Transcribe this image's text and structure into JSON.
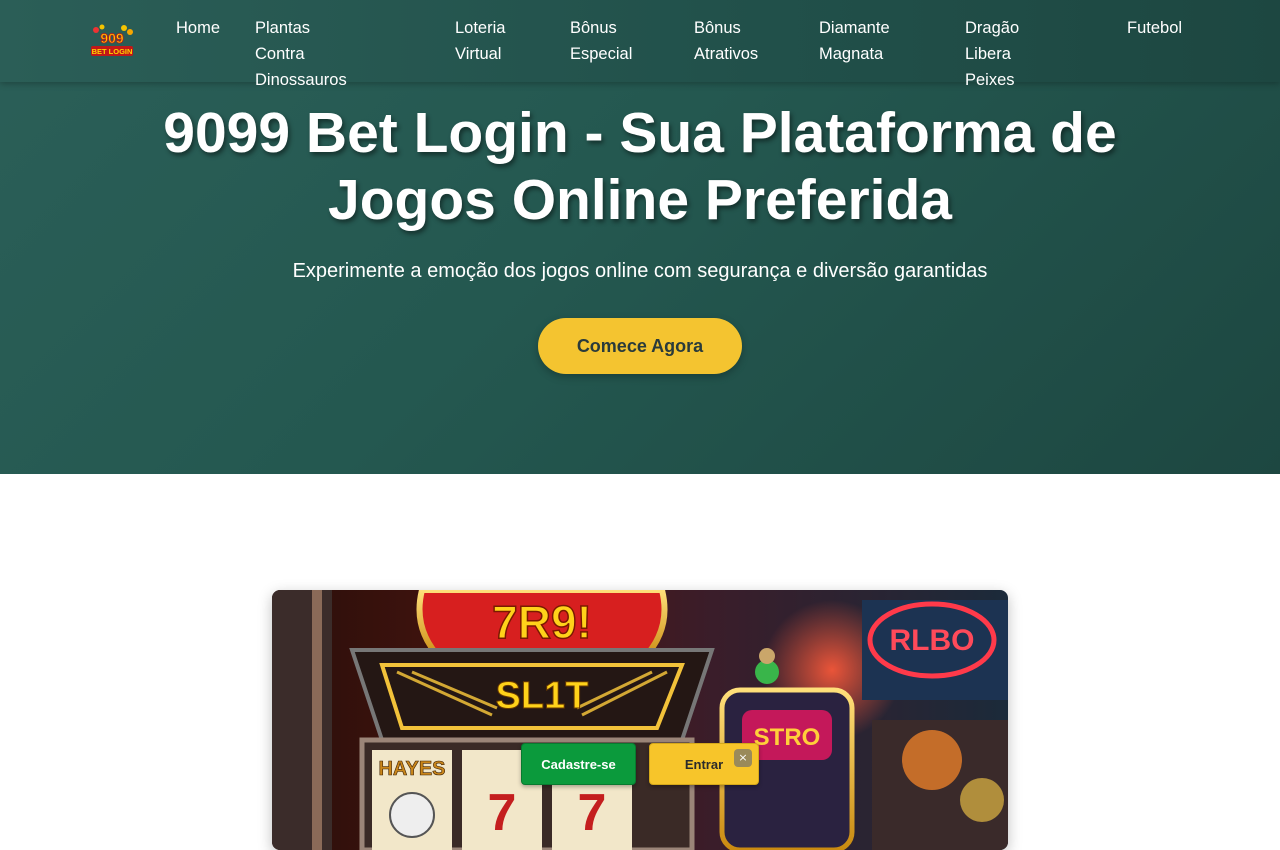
{
  "logo": {
    "text_top": "909",
    "text_bottom": "BET LOGIN"
  },
  "nav": {
    "items": [
      {
        "line1": "Home",
        "line2": ""
      },
      {
        "line1": "Plantas Contra",
        "line2": "Dinossauros"
      },
      {
        "line1": "Loteria",
        "line2": "Virtual"
      },
      {
        "line1": "Bônus",
        "line2": "Especial"
      },
      {
        "line1": "Bônus",
        "line2": "Atrativos"
      },
      {
        "line1": "Diamante",
        "line2": "Magnata"
      },
      {
        "line1": "Dragão Libera",
        "line2": "Peixes"
      },
      {
        "line1": "Futebol",
        "line2": ""
      }
    ]
  },
  "hero": {
    "title": "9099 Bet Login - Sua Plataforma de Jogos Online Preferida",
    "subtitle": "Experimente a emoção dos jogos online com segurança e diversão garantidas",
    "cta_label": "Comece Agora"
  },
  "image_card": {
    "visible_lettering": [
      "7R9!",
      "SL1T",
      "HAYES",
      "STRO",
      "RLBO"
    ]
  },
  "floating": {
    "register_label": "Cadastre-se",
    "login_label": "Entrar",
    "close_glyph": "×"
  },
  "colors": {
    "hero_bg": "#245850",
    "accent_yellow": "#f4c430",
    "register_green": "#0b9a3c"
  }
}
